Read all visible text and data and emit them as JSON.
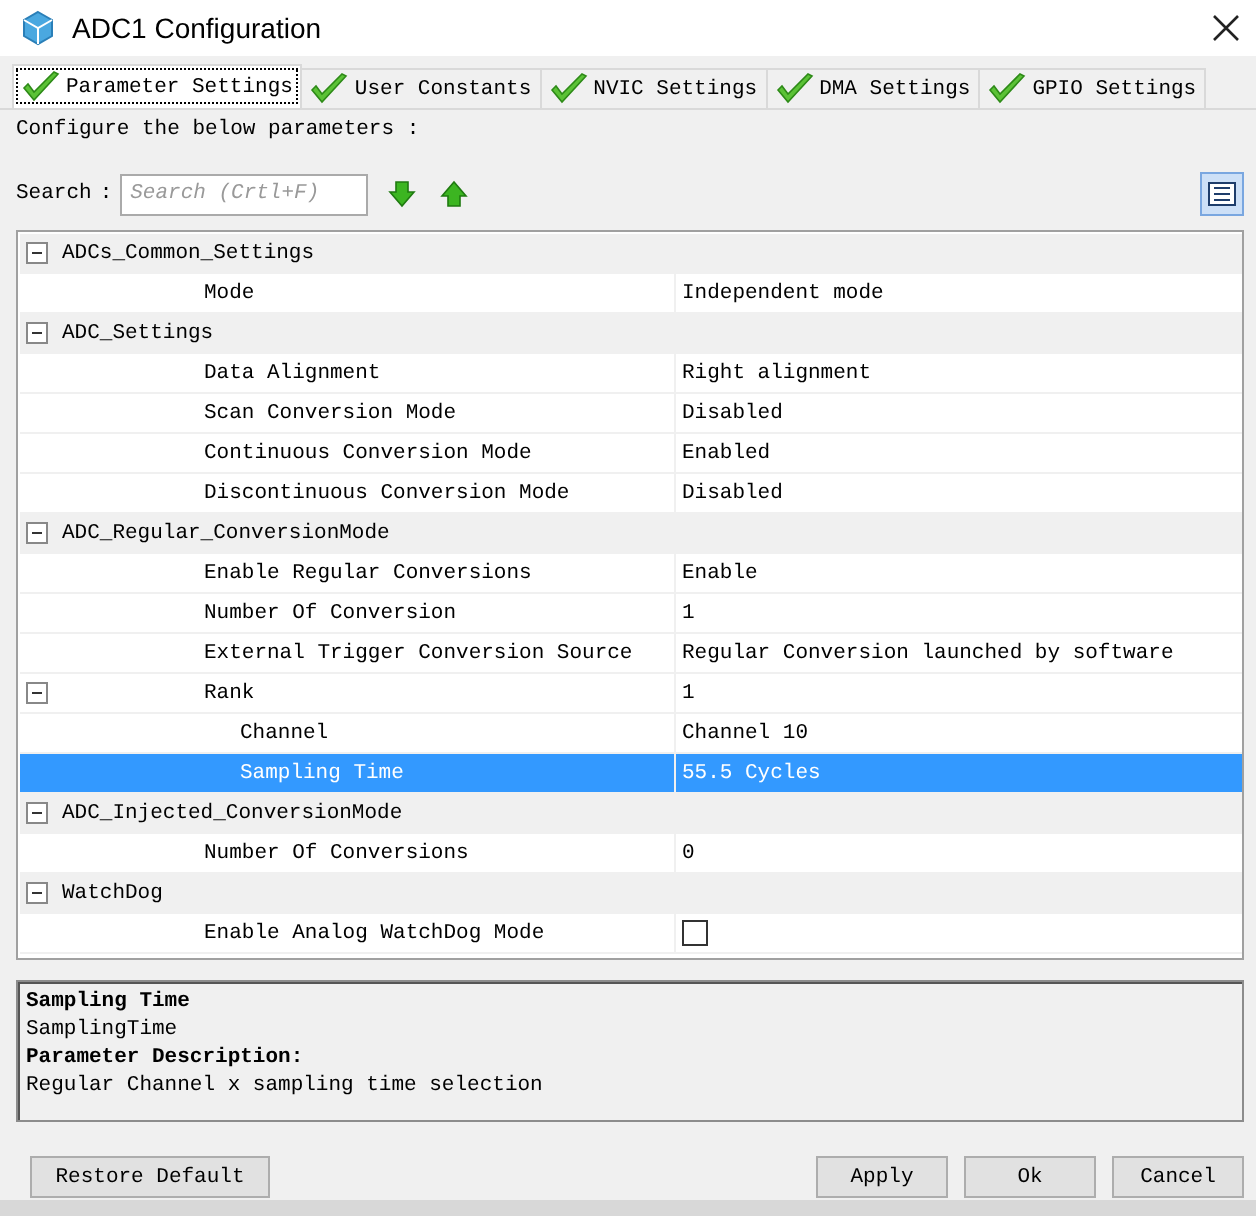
{
  "window": {
    "title": "ADC1 Configuration"
  },
  "tabs": [
    {
      "label": "Parameter Settings",
      "selected": true,
      "valid": true
    },
    {
      "label": "User Constants",
      "selected": false,
      "valid": true
    },
    {
      "label": "NVIC Settings",
      "selected": false,
      "valid": true
    },
    {
      "label": "DMA Settings",
      "selected": false,
      "valid": true
    },
    {
      "label": "GPIO Settings",
      "selected": false,
      "valid": true
    }
  ],
  "instruction": "Configure the below parameters :",
  "search": {
    "label": "Search",
    "separator": ":",
    "placeholder": "Search (Crtl+F)"
  },
  "tree": [
    {
      "name": "ADCs_Common_Settings",
      "expanded": true,
      "children": [
        {
          "label": "Mode",
          "kind": "text",
          "value": "Independent mode",
          "selected": false
        }
      ]
    },
    {
      "name": "ADC_Settings",
      "expanded": true,
      "children": [
        {
          "label": "Data Alignment",
          "kind": "text",
          "value": "Right alignment",
          "selected": false
        },
        {
          "label": "Scan Conversion Mode",
          "kind": "text",
          "value": "Disabled",
          "selected": false
        },
        {
          "label": "Continuous Conversion Mode",
          "kind": "text",
          "value": "Enabled",
          "selected": false
        },
        {
          "label": "Discontinuous Conversion Mode",
          "kind": "text",
          "value": "Disabled",
          "selected": false
        }
      ]
    },
    {
      "name": "ADC_Regular_ConversionMode",
      "expanded": true,
      "children": [
        {
          "label": "Enable Regular Conversions",
          "kind": "text",
          "value": "Enable",
          "selected": false
        },
        {
          "label": "Number Of Conversion",
          "kind": "text",
          "value": "1",
          "selected": false
        },
        {
          "label": "External Trigger Conversion Source",
          "kind": "text",
          "value": "Regular Conversion launched by software",
          "selected": false
        },
        {
          "label": "Rank",
          "kind": "text",
          "value": "1",
          "selected": false,
          "expanded": true,
          "children": [
            {
              "label": "Channel",
              "kind": "text",
              "value": "Channel 10",
              "selected": false
            },
            {
              "label": "Sampling Time",
              "kind": "text",
              "value": "55.5 Cycles",
              "selected": true
            }
          ]
        }
      ]
    },
    {
      "name": "ADC_Injected_ConversionMode",
      "expanded": true,
      "children": [
        {
          "label": "Number Of Conversions",
          "kind": "text",
          "value": "0",
          "selected": false
        }
      ]
    },
    {
      "name": "WatchDog",
      "expanded": true,
      "children": [
        {
          "label": "Enable Analog WatchDog Mode",
          "kind": "checkbox",
          "checked": false,
          "selected": false
        }
      ]
    }
  ],
  "description": {
    "title": "Sampling Time",
    "name": "SamplingTime",
    "heading": "Parameter Description:",
    "text": "Regular Channel x sampling time selection"
  },
  "buttons": {
    "left": [
      "Restore Default"
    ],
    "right": [
      "Apply",
      "Ok",
      "Cancel"
    ]
  }
}
